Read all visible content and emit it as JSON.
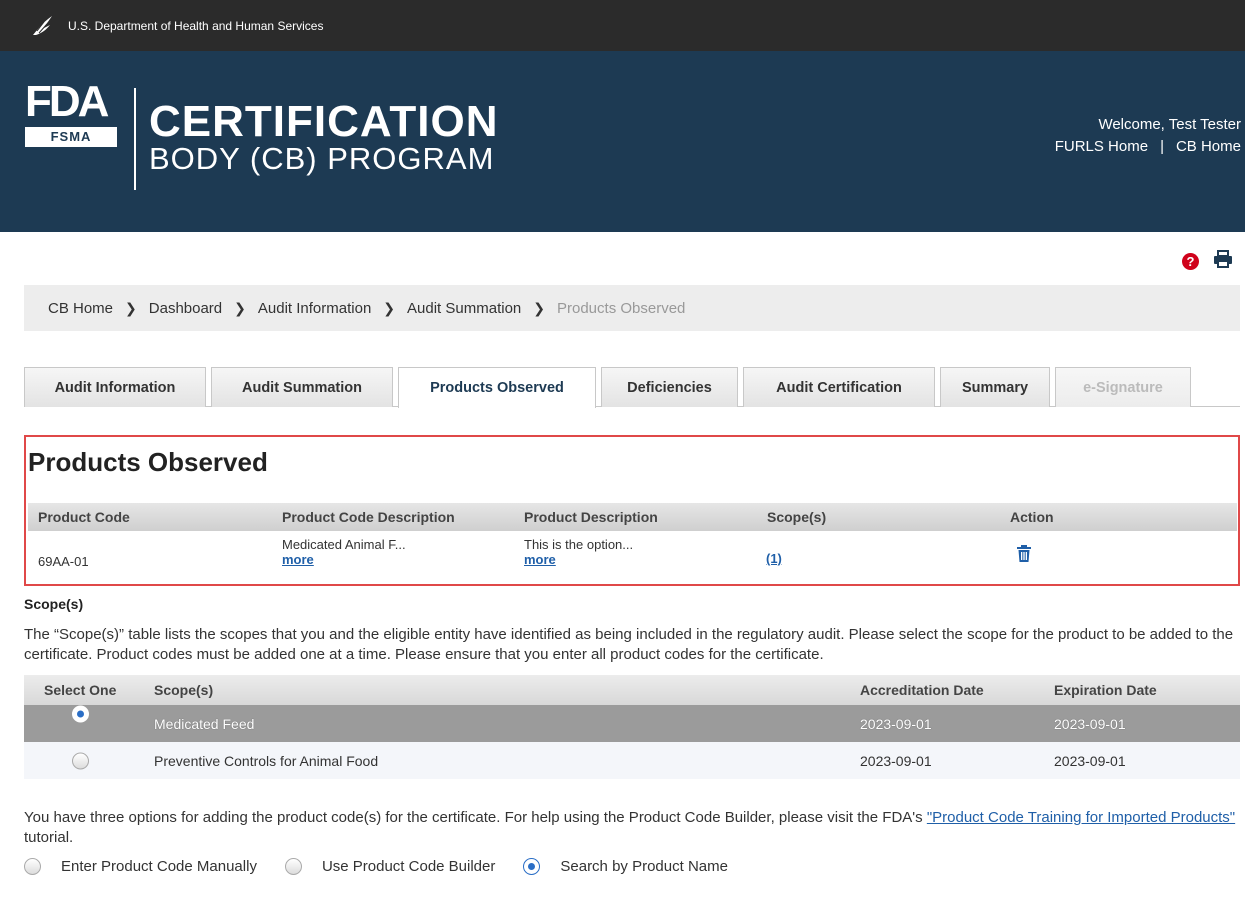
{
  "topbar": {
    "agency": "U.S. Department of Health and Human Services",
    "icon": "hhs-eagle-icon"
  },
  "banner": {
    "logo_text": "FDA",
    "logo_sub": "FSMA",
    "title_line1": "CERTIFICATION",
    "title_line2": "BODY (CB) PROGRAM",
    "welcome": "Welcome, Test Tester",
    "links": {
      "furls_home": "FURLS Home",
      "separator": "|",
      "cb_home": "CB Home"
    },
    "background_color": "#1d3a53"
  },
  "utility_icons": {
    "help": "?",
    "help_icon": "help-icon",
    "print_icon": "print-icon"
  },
  "breadcrumb": {
    "items": [
      "CB Home",
      "Dashboard",
      "Audit Information",
      "Audit Summation"
    ],
    "current": "Products Observed",
    "separator_icon": "chevron-right-icon"
  },
  "tabs": [
    {
      "label": "Audit Information",
      "state": "normal"
    },
    {
      "label": "Audit Summation",
      "state": "normal"
    },
    {
      "label": "Products Observed",
      "state": "active"
    },
    {
      "label": "Deficiencies",
      "state": "normal"
    },
    {
      "label": "Audit Certification",
      "state": "normal"
    },
    {
      "label": "Summary",
      "state": "normal"
    },
    {
      "label": "e-Signature",
      "state": "disabled"
    }
  ],
  "products_observed": {
    "title": "Products Observed",
    "columns": [
      "Product Code",
      "Product Code Description",
      "Product Description",
      "Scope(s)",
      "Action"
    ],
    "rows": [
      {
        "product_code": "69AA-01",
        "code_description": "Medicated Animal F...",
        "code_description_more": "more",
        "product_description": "This is the option...",
        "product_description_more": "more",
        "scopes": "(1)",
        "action_icon": "trash-icon"
      }
    ],
    "highlight_color": "#e04848"
  },
  "scopes": {
    "label": "Scope(s)",
    "description": "The “Scope(s)” table lists the scopes that you and the eligible entity have identified as being included in the regulatory audit. Please select the scope for the product to be added to the certificate. Product codes must be added one at a time. Please ensure that you enter all product codes for the certificate.",
    "columns": [
      "Select One",
      "Scope(s)",
      "Accreditation Date",
      "Expiration Date"
    ],
    "rows": [
      {
        "scope": "Medicated Feed",
        "accreditation_date": "2023-09-01",
        "expiration_date": "2023-09-01",
        "selected": true
      },
      {
        "scope": "Preventive Controls for Animal Food",
        "accreditation_date": "2023-09-01",
        "expiration_date": "2023-09-01",
        "selected": false
      }
    ]
  },
  "options": {
    "text_before": "You have three options for adding the product code(s) for the certificate. For help using the Product Code Builder, please visit the FDA's ",
    "link_text": "\"Product Code Training for Imported Products\"",
    "text_after": " tutorial.",
    "choices": [
      {
        "label": "Enter Product Code Manually",
        "selected": false
      },
      {
        "label": "Use Product Code Builder",
        "selected": false
      },
      {
        "label": "Search by Product Name",
        "selected": true
      }
    ]
  },
  "colors": {
    "link": "#1f5fa8",
    "selected_row": "#9b9b9b",
    "help_red": "#d0021b"
  }
}
